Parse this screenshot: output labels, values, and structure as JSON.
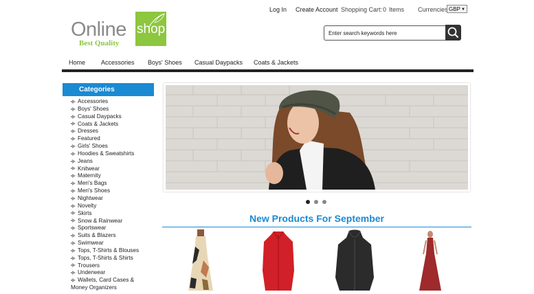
{
  "logo": {
    "word": "Online",
    "box_word": "shop",
    "tagline": "Best Quality"
  },
  "header": {
    "login": "Log In",
    "create_account": "Create Account",
    "cart_label": "Shopping Cart:",
    "cart_count": "0",
    "cart_items": "Items",
    "currencies_label": "Currencies:",
    "currency_selected": "GBP"
  },
  "search": {
    "placeholder": "Enter search keywords here"
  },
  "nav": {
    "home": "Home",
    "accessories": "Accessories",
    "boys_shoes": "Boys' Shoes",
    "casual_daypacks": "Casual Daypacks",
    "coats_jackets": "Coats & Jackets"
  },
  "sidebar": {
    "header": "Categories",
    "items": [
      "Accessories",
      "Boys' Shoes",
      "Casual Daypacks",
      "Coats & Jackets",
      "Dresses",
      "Featured",
      "Girls' Shoes",
      "Hoodies & Sweatshirts",
      "Jeans",
      "Knitwear",
      "Maternity",
      "Men's Bags",
      "Men's Shoes",
      "Nightwear",
      "Novelty",
      "Skirts",
      "Snow & Rainwear",
      "Sportswear",
      "Suits & Blazers",
      "Swimwear",
      "Tops, T-Shirts & Blouses",
      "Tops, T-Shirts & Shirts",
      "Trousers",
      "Underwear",
      "Wallets, Card Cases &"
    ],
    "continuation": "Money Organizers"
  },
  "new_products": {
    "title": "New Products For September"
  },
  "colors": {
    "accent": "#1a8ad3",
    "logo_green": "#8dc63f",
    "nav_bar": "#222222"
  }
}
